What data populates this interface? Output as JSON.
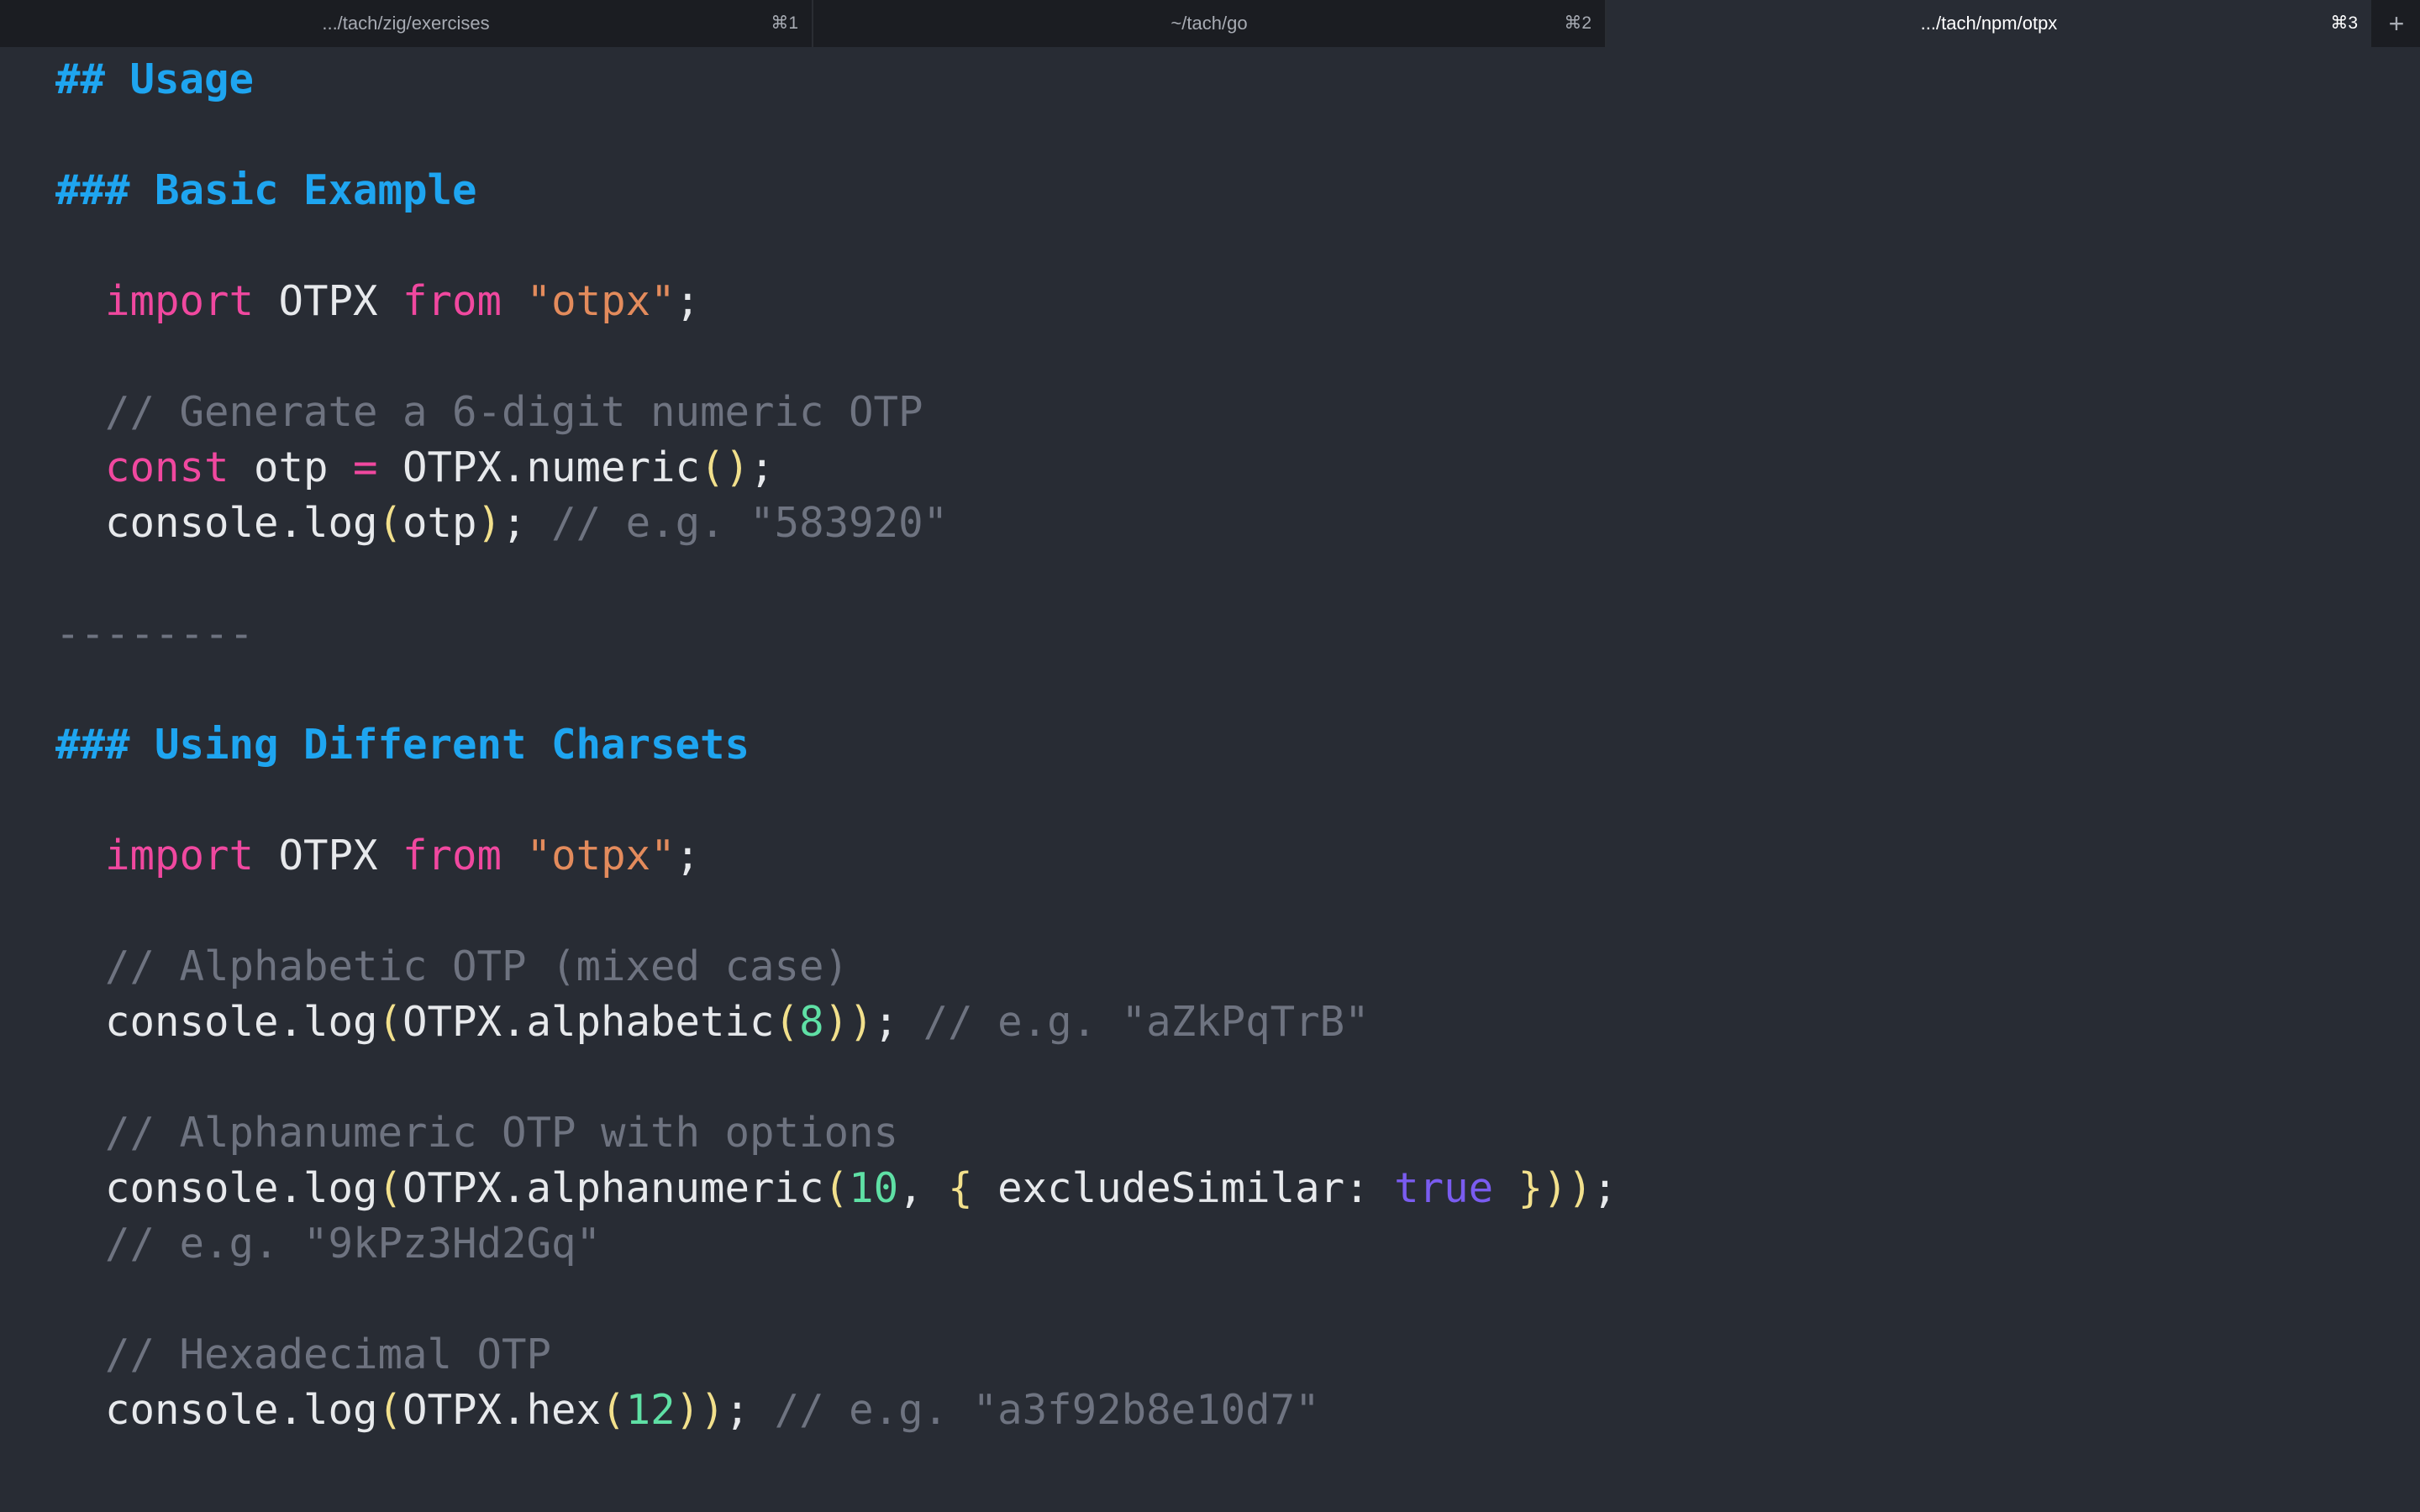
{
  "tabs": [
    {
      "title": ".../tach/zig/exercises",
      "shortcut": "⌘1"
    },
    {
      "title": "~/tach/go",
      "shortcut": "⌘2"
    },
    {
      "title": ".../tach/npm/otpx",
      "shortcut": "⌘3"
    }
  ],
  "new_tab_icon": "+",
  "doc": {
    "h_usage": "## Usage",
    "h_basic": "### Basic Example",
    "ex1": {
      "import_kw": "import",
      "import_name": " OTPX ",
      "from_kw": "from",
      "module": "\"otpx\"",
      "semi": ";",
      "comment_generate": "// Generate a 6-digit numeric OTP",
      "const_kw": "const",
      "otp_var": " otp ",
      "eq": "=",
      "numeric_call": " OTPX.numeric",
      "paren_open": "(",
      "paren_close": ")",
      "semi2": ";",
      "log_prefix": "console.log",
      "log_open": "(",
      "log_arg": "otp",
      "log_close": ")",
      "log_semi": "; ",
      "log_comment": "// e.g. \"583920\""
    },
    "hr": "--------",
    "h_charsets": "### Using Different Charsets",
    "ex2": {
      "import_kw": "import",
      "import_name": " OTPX ",
      "from_kw": "from",
      "module": "\"otpx\"",
      "semi": ";",
      "comment_alpha": "// Alphabetic OTP (mixed case)",
      "alpha_log": "console.log",
      "alpha_p1": "(",
      "alpha_call": "OTPX.alphabetic",
      "alpha_p2": "(",
      "alpha_num": "8",
      "alpha_p3": ")",
      "alpha_p4": ")",
      "alpha_semi": "; ",
      "alpha_comment": "// e.g. \"aZkPqTrB\"",
      "comment_alnum": "// Alphanumeric OTP with options",
      "alnum_log": "console.log",
      "alnum_p1": "(",
      "alnum_call": "OTPX.alphanumeric",
      "alnum_p2": "(",
      "alnum_num": "10",
      "alnum_comma": ", ",
      "alnum_brace_open": "{",
      "alnum_key": " excludeSimilar: ",
      "alnum_bool": "true",
      "alnum_space": " ",
      "alnum_brace_close": "}",
      "alnum_p3": ")",
      "alnum_p4": ")",
      "alnum_semi": ";",
      "alnum_comment": "// e.g. \"9kPz3Hd2Gq\"",
      "comment_hex": "// Hexadecimal OTP",
      "hex_log": "console.log",
      "hex_p1": "(",
      "hex_call": "OTPX.hex",
      "hex_p2": "(",
      "hex_num": "12",
      "hex_p3": ")",
      "hex_p4": ")",
      "hex_semi": "; ",
      "hex_comment": "// e.g. \"a3f92b8e10d7\""
    }
  }
}
